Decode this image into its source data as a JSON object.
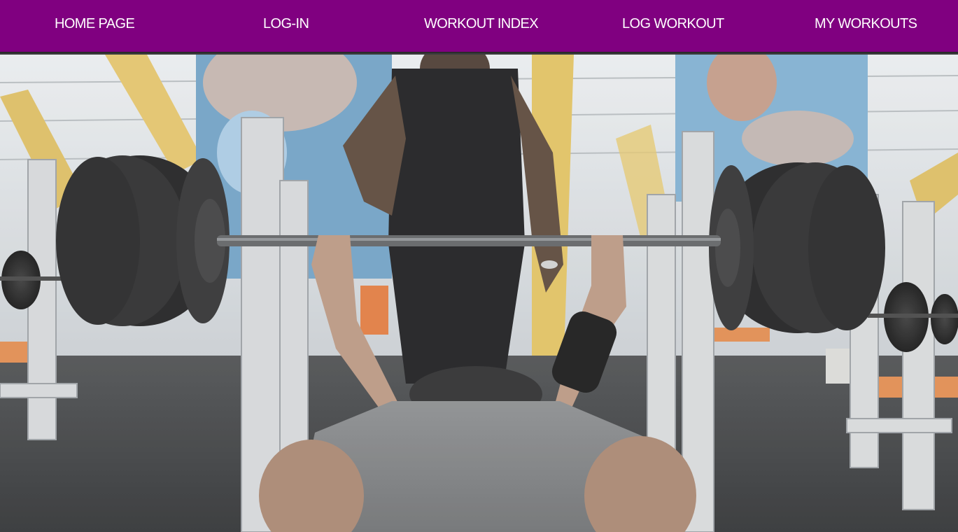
{
  "nav": {
    "items": [
      {
        "label": "HOME PAGE"
      },
      {
        "label": "LOG-IN"
      },
      {
        "label": "WORKOUT INDEX"
      },
      {
        "label": "LOG WORKOUT"
      },
      {
        "label": "MY WORKOUTS"
      }
    ]
  },
  "colors": {
    "nav_background": "#800080",
    "nav_text": "#ffffff"
  },
  "hero": {
    "image": "gym-bench-press-photo"
  }
}
